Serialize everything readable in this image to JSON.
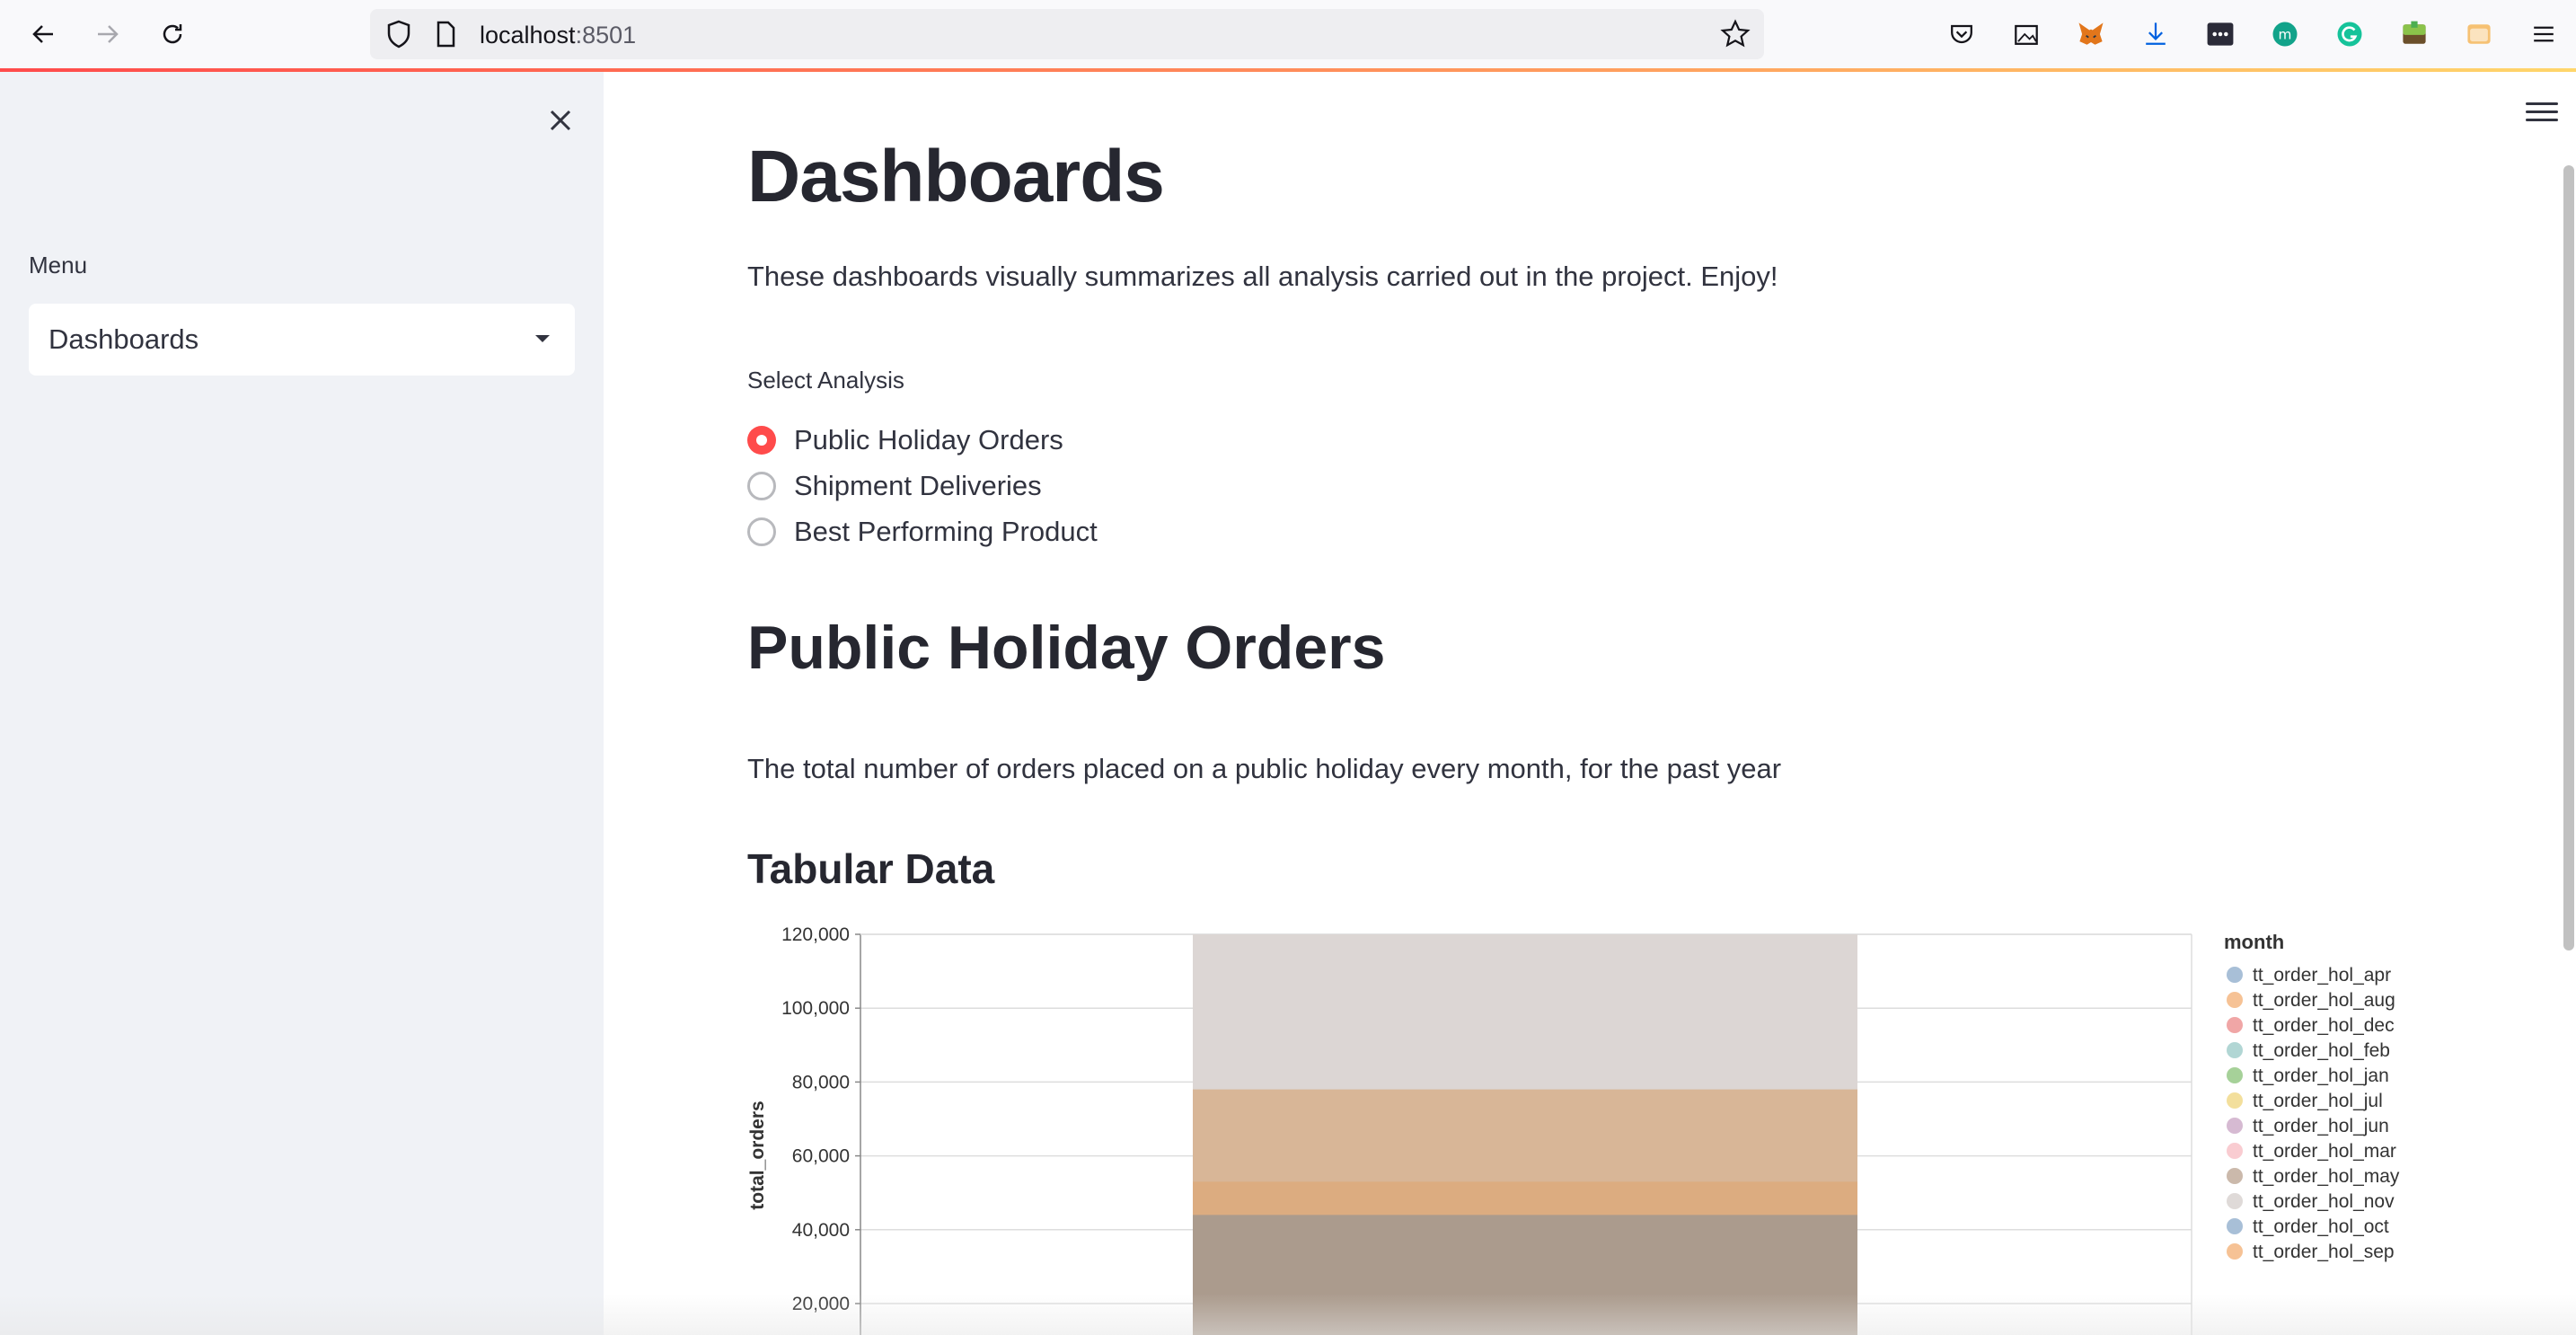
{
  "browser": {
    "url_host": "localhost",
    "url_port": ":8501"
  },
  "sidebar": {
    "menu_label": "Menu",
    "selected_page": "Dashboards"
  },
  "main": {
    "title": "Dashboards",
    "intro": "These dashboards visually summarizes all analysis carried out in the project. Enjoy!",
    "radio_label": "Select Analysis",
    "radio_options": [
      {
        "label": "Public Holiday Orders",
        "checked": true
      },
      {
        "label": "Shipment Deliveries",
        "checked": false
      },
      {
        "label": "Best Performing Product",
        "checked": false
      }
    ],
    "section_title": "Public Holiday Orders",
    "section_desc": "The total number of orders placed on a public holiday every month, for the past year",
    "subsection_title": "Tabular Data"
  },
  "chart_data": {
    "type": "bar",
    "stacked": true,
    "ylabel": "total_orders",
    "xlabel": "",
    "ylim": [
      0,
      120000
    ],
    "yticks": [
      "120,000",
      "100,000",
      "80,000",
      "60,000",
      "40,000",
      "20,000"
    ],
    "ytick_values": [
      120000,
      100000,
      80000,
      60000,
      40000,
      20000
    ],
    "legend_title": "month",
    "legend_position": "right",
    "series": [
      {
        "name": "tt_order_hol_apr",
        "color": "#9fb8d3"
      },
      {
        "name": "tt_order_hol_aug",
        "color": "#f5bb8a"
      },
      {
        "name": "tt_order_hol_dec",
        "color": "#ee9c9c"
      },
      {
        "name": "tt_order_hol_feb",
        "color": "#a9d1cf"
      },
      {
        "name": "tt_order_hol_jan",
        "color": "#9ccc8e"
      },
      {
        "name": "tt_order_hol_jul",
        "color": "#f2dc91"
      },
      {
        "name": "tt_order_hol_jun",
        "color": "#d1b3cd"
      },
      {
        "name": "tt_order_hol_mar",
        "color": "#f8c6cc"
      },
      {
        "name": "tt_order_hol_may",
        "color": "#c5b1a2"
      },
      {
        "name": "tt_order_hol_nov",
        "color": "#dcd6d4"
      },
      {
        "name": "tt_order_hol_oct",
        "color": "#9fb8d3"
      },
      {
        "name": "tt_order_hol_sep",
        "color": "#f5bb8a"
      }
    ],
    "bar_layers": [
      {
        "series": "tt_order_hol_nov",
        "value": 120000,
        "color": "#dcd6d4"
      },
      {
        "series": "tt_order_hol_sep",
        "value": 78000,
        "color": "#d8b697"
      },
      {
        "series": "tt_order_hol_aug",
        "value": 53000,
        "color": "#dcac80"
      },
      {
        "series": "tt_order_hol_may",
        "value": 44000,
        "color": "#ab9b8d"
      }
    ]
  }
}
